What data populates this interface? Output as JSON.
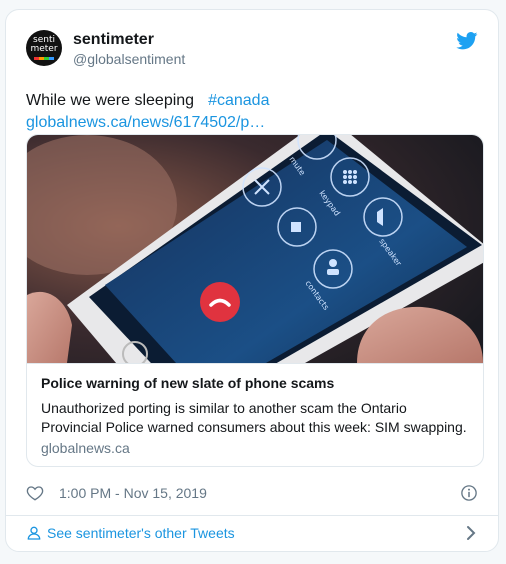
{
  "author": {
    "name": "sentimeter",
    "handle": "@globalsentiment",
    "avatar_text_top": "senti",
    "avatar_text_bottom": "meter"
  },
  "tweet": {
    "text": "While we were sleeping",
    "hashtag": "#canada",
    "link": "globalnews.ca/news/6174502/p…"
  },
  "card": {
    "title": "Police warning of new slate of phone scams",
    "description": "Unauthorized porting is similar to another scam the Ontario Provincial Police warned consumers about this week: SIM swapping.",
    "domain": "globalnews.ca",
    "image_labels": {
      "mute": "mute",
      "keypad": "keypad",
      "speaker": "speaker",
      "contacts": "contacts"
    }
  },
  "meta": {
    "timestamp": "1:00 PM - Nov 15, 2019"
  },
  "footer": {
    "link": "See sentimeter's other Tweets"
  },
  "colors": {
    "accent": "#1b95e0",
    "muted": "#657786",
    "border": "#e1e8ed",
    "end_call": "#e0333f"
  },
  "icons": {
    "brand": "twitter-bird-icon",
    "like": "heart-icon",
    "info": "info-icon",
    "profile": "person-icon",
    "more": "chevron-right-icon"
  }
}
